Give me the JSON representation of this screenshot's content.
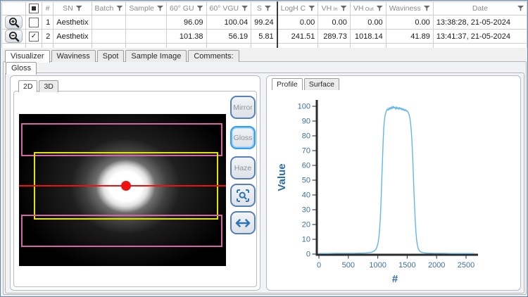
{
  "colors": {
    "accent_blue": "#2e75b6",
    "button_border": "#5580ba",
    "selected_button_border": "#2f9ff2",
    "curve": "#63b7e8",
    "tick_text": "#3e6fa3",
    "overlay_pink": "#d565a5",
    "overlay_yellow": "#e3e300",
    "overlay_red": "#ee1111"
  },
  "table": {
    "columns": [
      {
        "id": "tool",
        "label": "",
        "w": 27,
        "align": "center"
      },
      {
        "id": "select",
        "label": "",
        "w": 21,
        "align": "center",
        "type": "checkbox"
      },
      {
        "id": "num",
        "label": "#",
        "w": 20,
        "align": "right"
      },
      {
        "id": "sn",
        "label": "SN",
        "w": 42,
        "filter": true,
        "align": "left"
      },
      {
        "id": "batch",
        "label": "Batch",
        "w": 46,
        "filter": true,
        "align": "left"
      },
      {
        "id": "sample",
        "label": "Sample",
        "w": 50,
        "filter": true,
        "align": "left"
      },
      {
        "id": "gu60",
        "label": "60° GU",
        "w": 52,
        "filter": true,
        "align": "right"
      },
      {
        "id": "vgu60",
        "label": "60° VGU",
        "w": 53,
        "filter": true,
        "align": "right"
      },
      {
        "id": "s",
        "label": "S",
        "w": 36,
        "filter": true,
        "align": "right"
      },
      {
        "id": "loghc",
        "label": "LogH C",
        "w": 49,
        "filter": true,
        "align": "right",
        "thick_left": true
      },
      {
        "id": "vh_in",
        "label": "VH",
        "sublabel": "In",
        "w": 48,
        "filter": true,
        "align": "right"
      },
      {
        "id": "vh_out",
        "label": "VH",
        "sublabel": "Out",
        "w": 48,
        "filter": true,
        "align": "right"
      },
      {
        "id": "waviness",
        "label": "Waviness",
        "w": 61,
        "filter": true,
        "align": "right"
      },
      {
        "id": "date",
        "label": "Date",
        "w": 194,
        "filter": true,
        "align": "left",
        "label_center": true
      }
    ],
    "rows": [
      {
        "tool": "zoom-in",
        "selected": false,
        "num": "1",
        "sn": "Aesthetix",
        "batch": "",
        "sample": "",
        "gu60": "96.09",
        "vgu60": "100.04",
        "s": "99.24",
        "loghc": "0.00",
        "vh_in": "0.00",
        "vh_out": "0.00",
        "waviness": "0.00",
        "date": "13:38:28, 21-05-2024"
      },
      {
        "tool": "zoom-out",
        "selected": true,
        "num": "2",
        "sn": "Aesthetix",
        "batch": "",
        "sample": "",
        "gu60": "101.38",
        "vgu60": "56.19",
        "s": "5.81",
        "loghc": "241.51",
        "vh_in": "289.73",
        "vh_out": "1018.14",
        "waviness": "41.89",
        "date": "13:41:37, 21-05-2024"
      }
    ]
  },
  "main_tabs": {
    "items": [
      "Visualizer",
      "Waviness",
      "Spot",
      "Sample Image",
      "Comments:"
    ],
    "selected": "Visualizer"
  },
  "sub_tabs": {
    "items": [
      "Gloss"
    ],
    "selected": "Gloss"
  },
  "visualizer": {
    "view_tabs": {
      "items": [
        "2D",
        "3D"
      ],
      "selected": "2D"
    },
    "tool_buttons": [
      {
        "label": "Mirror",
        "selected": false
      },
      {
        "label": "Gloss",
        "selected": true
      },
      {
        "label": "Haze",
        "selected": false
      }
    ],
    "icon_buttons": [
      "zoom-region",
      "swap-horizontal"
    ]
  },
  "profile_panel": {
    "tabs": {
      "items": [
        "Profile",
        "Surface"
      ],
      "selected": "Profile"
    }
  },
  "chart_data": {
    "type": "line",
    "title": "",
    "xlabel": "#",
    "ylabel": "Value",
    "xlim": [
      0,
      2700
    ],
    "ylim": [
      0,
      100
    ],
    "xticks": [
      0,
      500,
      1000,
      1500,
      2000,
      2500
    ],
    "yticks": [
      0,
      10,
      20,
      30,
      40,
      50,
      60,
      70,
      80,
      90,
      100
    ],
    "grid": false,
    "legend": false,
    "series": [
      {
        "name": "gloss-profile",
        "color": "#63b7e8",
        "points": [
          [
            0,
            0.4
          ],
          [
            150,
            0.4
          ],
          [
            300,
            0.5
          ],
          [
            450,
            0.5
          ],
          [
            600,
            0.5
          ],
          [
            700,
            0.6
          ],
          [
            780,
            0.7
          ],
          [
            840,
            0.9
          ],
          [
            890,
            1.2
          ],
          [
            930,
            1.8
          ],
          [
            960,
            2.8
          ],
          [
            985,
            4.5
          ],
          [
            1005,
            7.5
          ],
          [
            1022,
            12
          ],
          [
            1036,
            19
          ],
          [
            1048,
            28
          ],
          [
            1060,
            40
          ],
          [
            1071,
            53
          ],
          [
            1082,
            66
          ],
          [
            1092,
            77
          ],
          [
            1102,
            85
          ],
          [
            1112,
            90.5
          ],
          [
            1124,
            93.8
          ],
          [
            1137,
            95.8
          ],
          [
            1150,
            97.0
          ],
          [
            1163,
            98.2
          ],
          [
            1176,
            97.3
          ],
          [
            1189,
            98.9
          ],
          [
            1202,
            97.8
          ],
          [
            1215,
            99.3
          ],
          [
            1228,
            98.2
          ],
          [
            1241,
            99.8
          ],
          [
            1254,
            98.5
          ],
          [
            1267,
            99.9
          ],
          [
            1280,
            98.8
          ],
          [
            1293,
            99.4
          ],
          [
            1306,
            98.0
          ],
          [
            1319,
            99.6
          ],
          [
            1332,
            98.4
          ],
          [
            1345,
            99.1
          ],
          [
            1358,
            97.9
          ],
          [
            1371,
            99.2
          ],
          [
            1384,
            98.1
          ],
          [
            1397,
            98.8
          ],
          [
            1410,
            97.6
          ],
          [
            1423,
            98.5
          ],
          [
            1436,
            97.3
          ],
          [
            1449,
            98.0
          ],
          [
            1462,
            97.0
          ],
          [
            1475,
            97.7
          ],
          [
            1488,
            96.6
          ],
          [
            1500,
            96.9
          ],
          [
            1512,
            96.2
          ],
          [
            1524,
            95.3
          ],
          [
            1536,
            93.8
          ],
          [
            1548,
            91.5
          ],
          [
            1559,
            88
          ],
          [
            1570,
            83
          ],
          [
            1581,
            76
          ],
          [
            1592,
            67
          ],
          [
            1603,
            56
          ],
          [
            1614,
            44
          ],
          [
            1625,
            33
          ],
          [
            1636,
            23
          ],
          [
            1648,
            15
          ],
          [
            1660,
            9.5
          ],
          [
            1673,
            6
          ],
          [
            1688,
            3.8
          ],
          [
            1705,
            2.4
          ],
          [
            1725,
            1.6
          ],
          [
            1750,
            1.1
          ],
          [
            1790,
            0.8
          ],
          [
            1850,
            0.6
          ],
          [
            1950,
            0.5
          ],
          [
            2080,
            0.5
          ],
          [
            2250,
            0.4
          ],
          [
            2420,
            0.4
          ],
          [
            2630,
            0.4
          ]
        ]
      }
    ]
  }
}
